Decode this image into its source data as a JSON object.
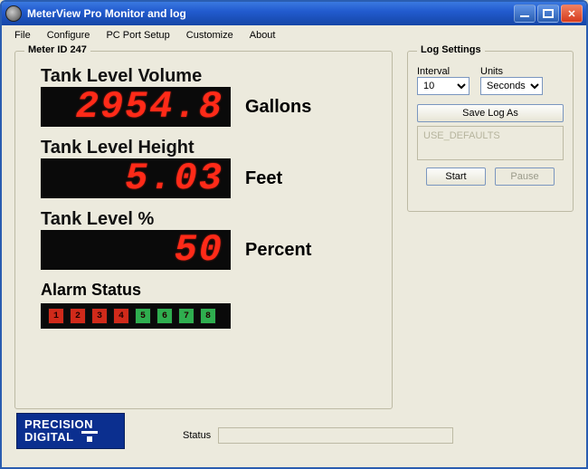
{
  "window": {
    "title": "MeterView Pro Monitor and log"
  },
  "menus": {
    "file": "File",
    "configure": "Configure",
    "pcport": "PC Port Setup",
    "customize": "Customize",
    "about": "About"
  },
  "meter": {
    "legend": "Meter ID 247",
    "readings": [
      {
        "label": "Tank Level Volume",
        "value": "2954.8",
        "unit": "Gallons"
      },
      {
        "label": "Tank Level Height",
        "value": "5.03",
        "unit": "Feet"
      },
      {
        "label": "Tank Level %",
        "value": "50",
        "unit": "Percent"
      }
    ],
    "alarm_label": "Alarm Status",
    "alarms": [
      {
        "n": "1",
        "state": "red"
      },
      {
        "n": "2",
        "state": "red"
      },
      {
        "n": "3",
        "state": "red"
      },
      {
        "n": "4",
        "state": "red"
      },
      {
        "n": "5",
        "state": "green"
      },
      {
        "n": "6",
        "state": "green"
      },
      {
        "n": "7",
        "state": "green"
      },
      {
        "n": "8",
        "state": "green"
      }
    ]
  },
  "log": {
    "legend": "Log Settings",
    "interval_label": "Interval",
    "interval_value": "10",
    "units_label": "Units",
    "units_value": "Seconds",
    "save_button": "Save Log As",
    "file_placeholder": "USE_DEFAULTS",
    "start": "Start",
    "pause": "Pause"
  },
  "brand": {
    "line1": "PRECISION",
    "line2": "DIGITAL"
  },
  "status": {
    "label": "Status",
    "value": ""
  }
}
